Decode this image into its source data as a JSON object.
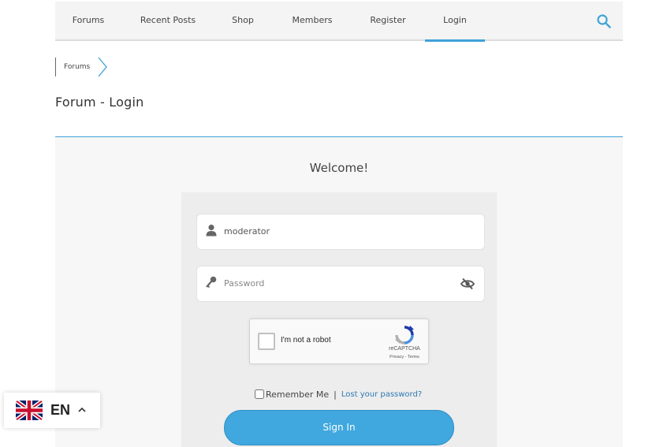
{
  "nav": {
    "items": [
      {
        "label": "Forums"
      },
      {
        "label": "Recent Posts"
      },
      {
        "label": "Shop"
      },
      {
        "label": "Members"
      },
      {
        "label": "Register"
      },
      {
        "label": "Login",
        "active": true
      }
    ],
    "search_icon": "search-icon"
  },
  "breadcrumb": {
    "items": [
      "Forums"
    ]
  },
  "page": {
    "title": "Forum - Login"
  },
  "form": {
    "welcome": "Welcome!",
    "username_value": "moderator",
    "password_placeholder": "Password",
    "recaptcha": {
      "label": "I'm not a robot",
      "brand": "reCAPTCHA",
      "terms": "Privacy - Terms"
    },
    "remember_label": "Remember Me",
    "separator": "|",
    "lost_password": "Lost your password?",
    "submit_label": "Sign In"
  },
  "language": {
    "code": "EN",
    "flag": "uk-flag-icon"
  },
  "colors": {
    "accent": "#40a8df",
    "link": "#2d79b4",
    "rule": "#3ea3d8"
  }
}
